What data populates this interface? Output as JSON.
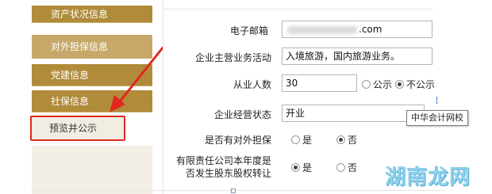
{
  "sidebar": {
    "items": [
      {
        "label": "资产状况信息"
      },
      {
        "label": "对外担保信息"
      },
      {
        "label": "党建信息"
      },
      {
        "label": "社保信息"
      },
      {
        "label": "预览并公示"
      }
    ]
  },
  "form": {
    "email": {
      "label": "电子邮箱",
      "value": ".com"
    },
    "business": {
      "label": "企业主营业务活动",
      "value": "入境旅游，国内旅游业务。"
    },
    "employees": {
      "label": "从业人数",
      "value": "30",
      "options": [
        "公示",
        "不公示"
      ],
      "selected": "不公示"
    },
    "status": {
      "label": "企业经营状态",
      "value": "开业"
    },
    "guarantee": {
      "label": "是否有对外担保",
      "options": [
        "是",
        "否"
      ],
      "selected": "否"
    },
    "equity": {
      "label_line1": "有限责任公司本年度是",
      "label_line2": "否发生股东股权转让",
      "options": [
        "是",
        "否"
      ],
      "selected": "是"
    }
  },
  "tooltip": {
    "text": "中华会计网校"
  },
  "watermark": {
    "text": "湖南龙网"
  },
  "colors": {
    "sidebar_gold": "#b08b3a",
    "highlight_red": "#e0281e"
  }
}
